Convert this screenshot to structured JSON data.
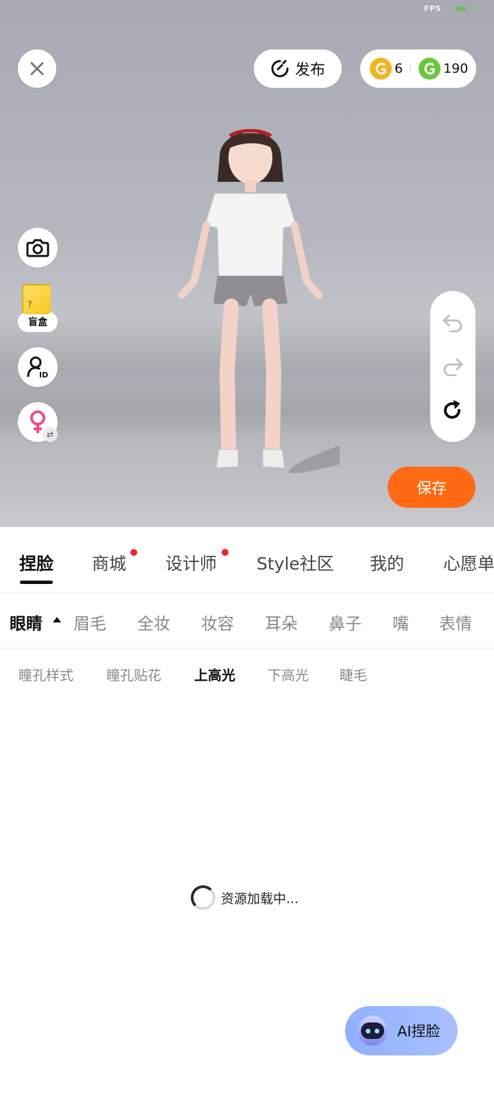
{
  "status": {
    "fps_label": "FPS"
  },
  "header": {
    "publish_label": "发布",
    "gold_coins": "6",
    "green_coins": "190"
  },
  "left_tools": {
    "blindbox_label": "盲盒"
  },
  "actions": {
    "save_label": "保存"
  },
  "main_tabs": [
    {
      "label": "捏脸",
      "active": true,
      "dot": false
    },
    {
      "label": "商城",
      "active": false,
      "dot": true
    },
    {
      "label": "设计师",
      "active": false,
      "dot": true
    },
    {
      "label": "Style社区",
      "active": false,
      "dot": false
    },
    {
      "label": "我的",
      "active": false,
      "dot": false
    },
    {
      "label": "心愿单",
      "active": false,
      "dot": false
    }
  ],
  "sub_tabs": [
    {
      "label": "眼睛",
      "active": true
    },
    {
      "label": "眉毛",
      "active": false
    },
    {
      "label": "全妆",
      "active": false
    },
    {
      "label": "妆容",
      "active": false
    },
    {
      "label": "耳朵",
      "active": false
    },
    {
      "label": "鼻子",
      "active": false
    },
    {
      "label": "嘴",
      "active": false
    },
    {
      "label": "表情",
      "active": false
    }
  ],
  "third_tabs": [
    {
      "label": "瞳孔样式",
      "active": false
    },
    {
      "label": "瞳孔贴花",
      "active": false
    },
    {
      "label": "上高光",
      "active": true
    },
    {
      "label": "下高光",
      "active": false
    },
    {
      "label": "睫毛",
      "active": false
    }
  ],
  "loading": {
    "text": "资源加载中..."
  },
  "ai_button": {
    "label": "AI捏脸"
  },
  "colors": {
    "accent": "#ff6a13",
    "red_dot": "#f2222d",
    "gold": "#f4b41f",
    "green": "#6cc63c"
  }
}
